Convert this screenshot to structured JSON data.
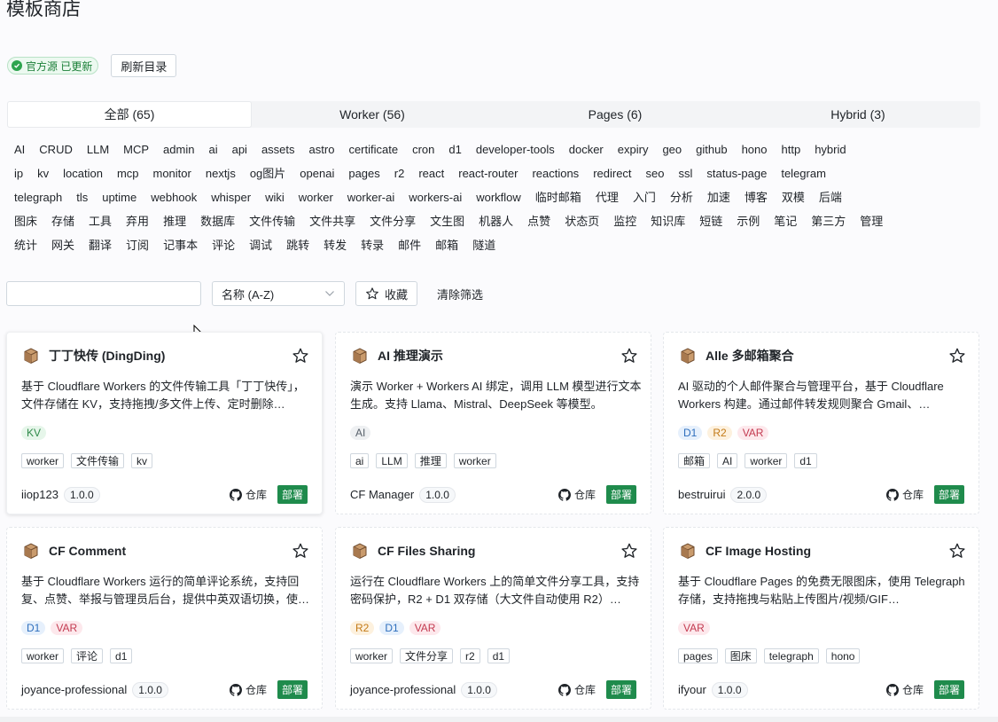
{
  "header": {
    "title": "模板商店"
  },
  "source": {
    "badge_label": "官方源 已更新",
    "refresh_label": "刷新目录"
  },
  "tabs": [
    {
      "label": "全部 (65)",
      "active": true
    },
    {
      "label": "Worker (56)",
      "active": false
    },
    {
      "label": "Pages (6)",
      "active": false
    },
    {
      "label": "Hybrid (3)",
      "active": false
    }
  ],
  "tag_rows": [
    [
      "AI",
      "CRUD",
      "LLM",
      "MCP",
      "admin",
      "ai",
      "api",
      "assets",
      "astro",
      "certificate",
      "cron",
      "d1",
      "developer-tools",
      "docker",
      "expiry",
      "geo",
      "github",
      "hono",
      "http",
      "hybrid"
    ],
    [
      "ip",
      "kv",
      "location",
      "mcp",
      "monitor",
      "nextjs",
      "og图片",
      "openai",
      "pages",
      "r2",
      "react",
      "react-router",
      "reactions",
      "redirect",
      "seo",
      "ssl",
      "status-page",
      "telegram"
    ],
    [
      "telegraph",
      "tls",
      "uptime",
      "webhook",
      "whisper",
      "wiki",
      "worker",
      "worker-ai",
      "workers-ai",
      "workflow",
      "临时邮箱",
      "代理",
      "入门",
      "分析",
      "加速",
      "博客",
      "双模",
      "后端"
    ],
    [
      "图床",
      "存储",
      "工具",
      "弃用",
      "推理",
      "数据库",
      "文件传输",
      "文件共享",
      "文件分享",
      "文生图",
      "机器人",
      "点赞",
      "状态页",
      "监控",
      "知识库",
      "短链",
      "示例",
      "笔记",
      "第三方",
      "管理"
    ],
    [
      "统计",
      "网关",
      "翻译",
      "订阅",
      "记事本",
      "评论",
      "调试",
      "跳转",
      "转发",
      "转录",
      "邮件",
      "邮箱",
      "隧道"
    ]
  ],
  "filters": {
    "search_value": "",
    "sort_value": "名称 (A-Z)",
    "fav_label": "收藏",
    "clear_label": "清除筛选"
  },
  "card_labels": {
    "repo": "仓库",
    "deploy": "部署"
  },
  "cards": [
    {
      "title": "丁丁快传 (DingDing)",
      "desc": "基于 Cloudflare Workers 的文件传输工具「丁丁快传」，文件存储在 KV，支持拖拽/多文件上传、定时删除…",
      "bindings": [
        {
          "label": "KV",
          "kind": "kv"
        }
      ],
      "tags": [
        "worker",
        "文件传输",
        "kv"
      ],
      "author": "iiop123",
      "version": "1.0.0"
    },
    {
      "title": "AI 推理演示",
      "desc": "演示 Worker + Workers AI 绑定，调用 LLM 模型进行文本生成。支持 Llama、Mistral、DeepSeek 等模型。",
      "bindings": [
        {
          "label": "AI",
          "kind": "ai"
        }
      ],
      "tags": [
        "ai",
        "LLM",
        "推理",
        "worker"
      ],
      "author": "CF Manager",
      "version": "1.0.0"
    },
    {
      "title": "Alle 多邮箱聚合",
      "desc": "AI 驱动的个人邮件聚合与管理平台，基于 Cloudflare Workers 构建。通过邮件转发规则聚合 Gmail、…",
      "bindings": [
        {
          "label": "D1",
          "kind": "d1"
        },
        {
          "label": "R2",
          "kind": "r2"
        },
        {
          "label": "VAR",
          "kind": "var"
        }
      ],
      "tags": [
        "邮箱",
        "AI",
        "worker",
        "d1"
      ],
      "author": "bestruirui",
      "version": "2.0.0"
    },
    {
      "title": "CF Comment",
      "desc": "基于 Cloudflare Workers 运行的简单评论系统，支持回复、点赞、举报与管理员后台，提供中英双语切换，使…",
      "bindings": [
        {
          "label": "D1",
          "kind": "d1"
        },
        {
          "label": "VAR",
          "kind": "var"
        }
      ],
      "tags": [
        "worker",
        "评论",
        "d1"
      ],
      "author": "joyance-professional",
      "version": "1.0.0"
    },
    {
      "title": "CF Files Sharing",
      "desc": "运行在 Cloudflare Workers 上的简单文件分享工具，支持密码保护，R2 + D1 双存储（大文件自动使用 R2）…",
      "bindings": [
        {
          "label": "R2",
          "kind": "r2"
        },
        {
          "label": "D1",
          "kind": "d1"
        },
        {
          "label": "VAR",
          "kind": "var"
        }
      ],
      "tags": [
        "worker",
        "文件分享",
        "r2",
        "d1"
      ],
      "author": "joyance-professional",
      "version": "1.0.0"
    },
    {
      "title": "CF Image Hosting",
      "desc": "基于 Cloudflare Pages 的免费无限图床，使用 Telegraph 存储，支持拖拽与粘贴上传图片/视频/GIF…",
      "bindings": [
        {
          "label": "VAR",
          "kind": "var"
        }
      ],
      "tags": [
        "pages",
        "图床",
        "telegraph",
        "hono"
      ],
      "author": "ifyour",
      "version": "1.0.0"
    }
  ]
}
